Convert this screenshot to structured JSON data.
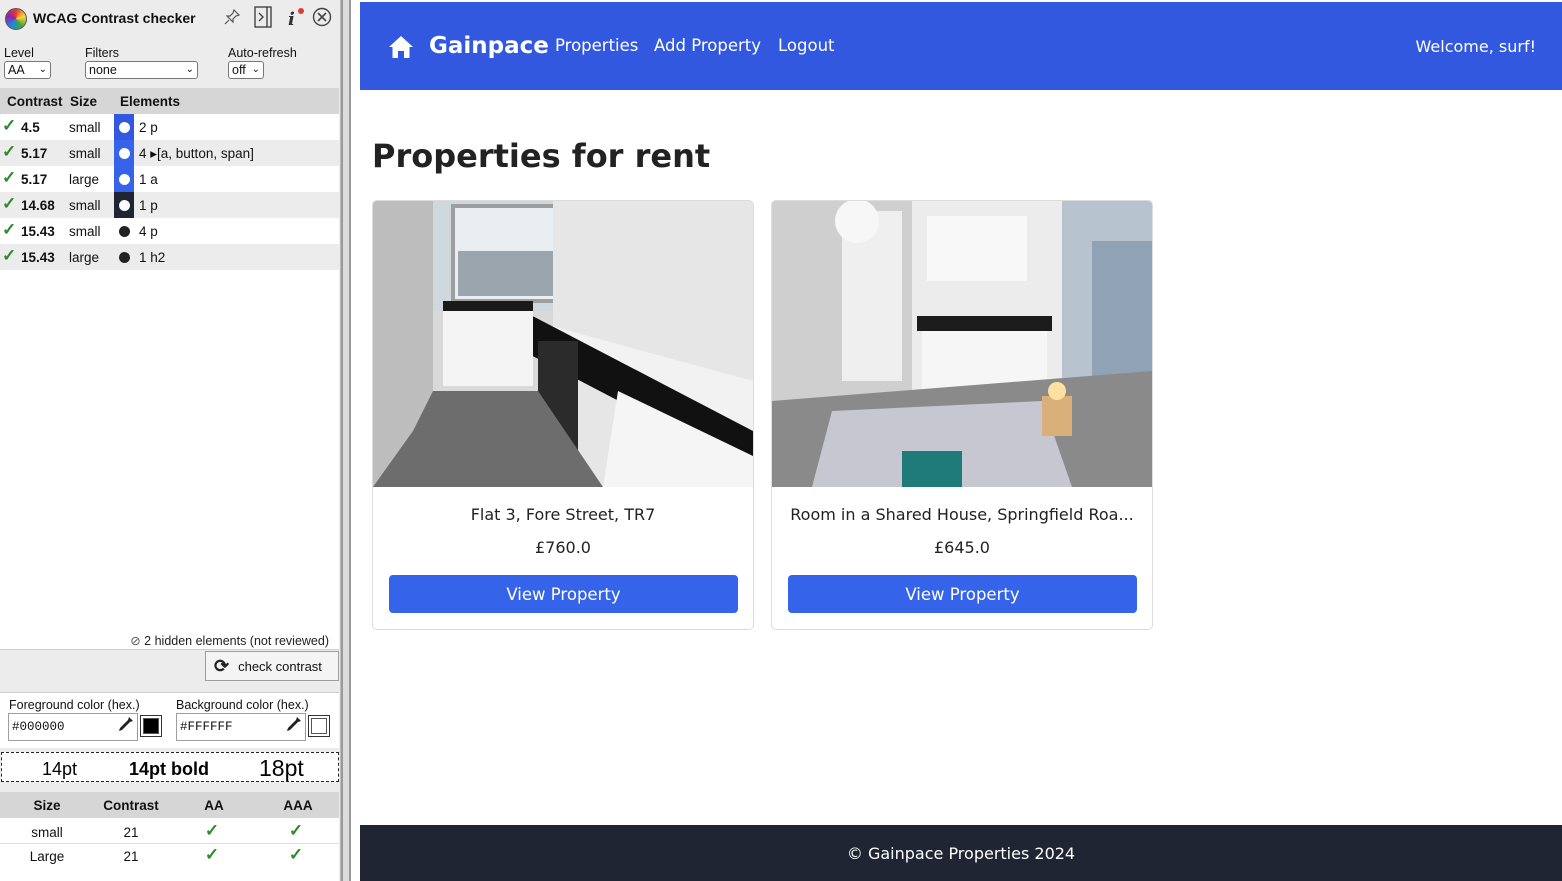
{
  "checker": {
    "title": "WCAG Contrast checker",
    "icons": [
      "pin-icon",
      "dock-icon",
      "info-icon",
      "close-icon"
    ],
    "level_label": "Level",
    "level_value": "AA",
    "filters_label": "Filters",
    "filters_value": "none",
    "autorefresh_label": "Auto-refresh",
    "autorefresh_value": "off",
    "columns": {
      "contrast": "Contrast",
      "size": "Size",
      "elements": "Elements"
    },
    "check_mark": "✓",
    "rows": [
      {
        "contrast": "4.5",
        "size": "small",
        "elements": "2 p",
        "bg": "#3358e0",
        "dot": "#ffffff"
      },
      {
        "contrast": "5.17",
        "size": "small",
        "elements": "4 ▸[a, button, span]",
        "bg": "#3564eb",
        "dot": "#ffffff"
      },
      {
        "contrast": "5.17",
        "size": "large",
        "elements": "1 a",
        "bg": "#3564eb",
        "dot": "#ffffff"
      },
      {
        "contrast": "14.68",
        "size": "small",
        "elements": "1 p",
        "bg": "#1f2532",
        "dot": "#ffffff"
      },
      {
        "contrast": "15.43",
        "size": "small",
        "elements": "4 p",
        "bg": "#ffffff",
        "dot": "#222222"
      },
      {
        "contrast": "15.43",
        "size": "large",
        "elements": "1 h2",
        "bg": "#ffffff",
        "dot": "#222222"
      }
    ],
    "hidden_note": "2 hidden elements (not reviewed)",
    "check_button": "check contrast",
    "fg_label": "Foreground color (hex.)",
    "fg_value": "#000000",
    "bg_label": "Background color (hex.)",
    "bg_value": "#FFFFFF",
    "sample_14": "14pt",
    "sample_14b": "14pt bold",
    "sample_18": "18pt",
    "summary_cols": {
      "size": "Size",
      "contrast": "Contrast",
      "aa": "AA",
      "aaa": "AAA"
    },
    "summary_rows": [
      {
        "size": "small",
        "contrast": "21",
        "aa": "✓",
        "aaa": "✓"
      },
      {
        "size": "Large",
        "contrast": "21",
        "aa": "✓",
        "aaa": "✓"
      }
    ]
  },
  "site": {
    "brand": "Gainpace",
    "nav": [
      "Properties",
      "Add Property",
      "Logout"
    ],
    "welcome": "Welcome, surf!",
    "heading": "Properties for rent",
    "properties": [
      {
        "name": "Flat 3, Fore Street, TR7",
        "price": "£760.0",
        "button": "View Property"
      },
      {
        "name": "Room in a Shared House, Springfield Roa...",
        "price": "£645.0",
        "button": "View Property"
      }
    ],
    "footer": "© Gainpace Properties 2024",
    "colors": {
      "primary": "#3358e0",
      "button": "#3564eb",
      "footer": "#1f2532"
    }
  }
}
